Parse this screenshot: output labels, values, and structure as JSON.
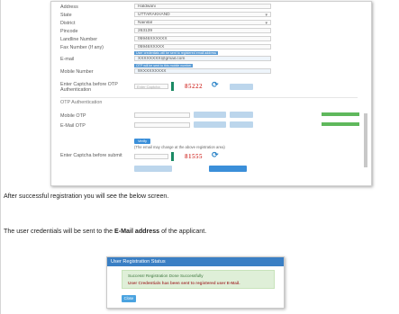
{
  "form": {
    "fields": [
      {
        "label": "Address",
        "value": "Haldwani"
      },
      {
        "label": "State",
        "value": "UTTARAKHAND"
      },
      {
        "label": "District",
        "value": "Nainital"
      },
      {
        "label": "Pincode",
        "value": "263139"
      },
      {
        "label": "Landline Number",
        "value": "05946XXXXXX"
      },
      {
        "label": "Fax Number (If any)",
        "value": "05946XXXXX"
      },
      {
        "label": "E-mail",
        "value": "XXXXXXXX@gmail.com",
        "tag": "User credentials will be sent to registered email address"
      },
      {
        "label": "Mobile Number",
        "value": "9XXXXXXXXX",
        "tag": "OTP will be sent to this mobile number"
      }
    ],
    "captcha_label": "Enter Captcha before OTP Authentication",
    "captcha_placeholder": "Enter Captcha",
    "captcha_code": "85222",
    "otp_section_title": "OTP Authentication",
    "mobile_otp_label": "Mobile OTP",
    "email_otp_label": "E-Mail OTP",
    "verify_label": "Verify",
    "note": "(The email may change at the above registration area)",
    "submit_captcha_label": "Enter Captcha before submit",
    "submit_captcha_code": "81555"
  },
  "text": {
    "after_registration": "After successful registration you will see the below screen.",
    "credentials_prefix": "The user credentials will be sent to the ",
    "credentials_bold": "E-Mail address",
    "credentials_suffix": " of the applicant."
  },
  "status_dialog": {
    "title": "User Registration Status",
    "success_line": "Success! Registration Done Successfully",
    "info_line": "User Credentials has been sent to registered user E-Mail.",
    "ok_label": "Close"
  },
  "colors": {
    "header_blue": "#3a7fc4",
    "alert_green_bg": "#dfefd8",
    "alert_red_text": "#a94442",
    "captcha_red": "#d9534f",
    "accent_green": "#5fb85c"
  },
  "icons": [
    "refresh-icon",
    "dropdown-chevron-icon"
  ]
}
